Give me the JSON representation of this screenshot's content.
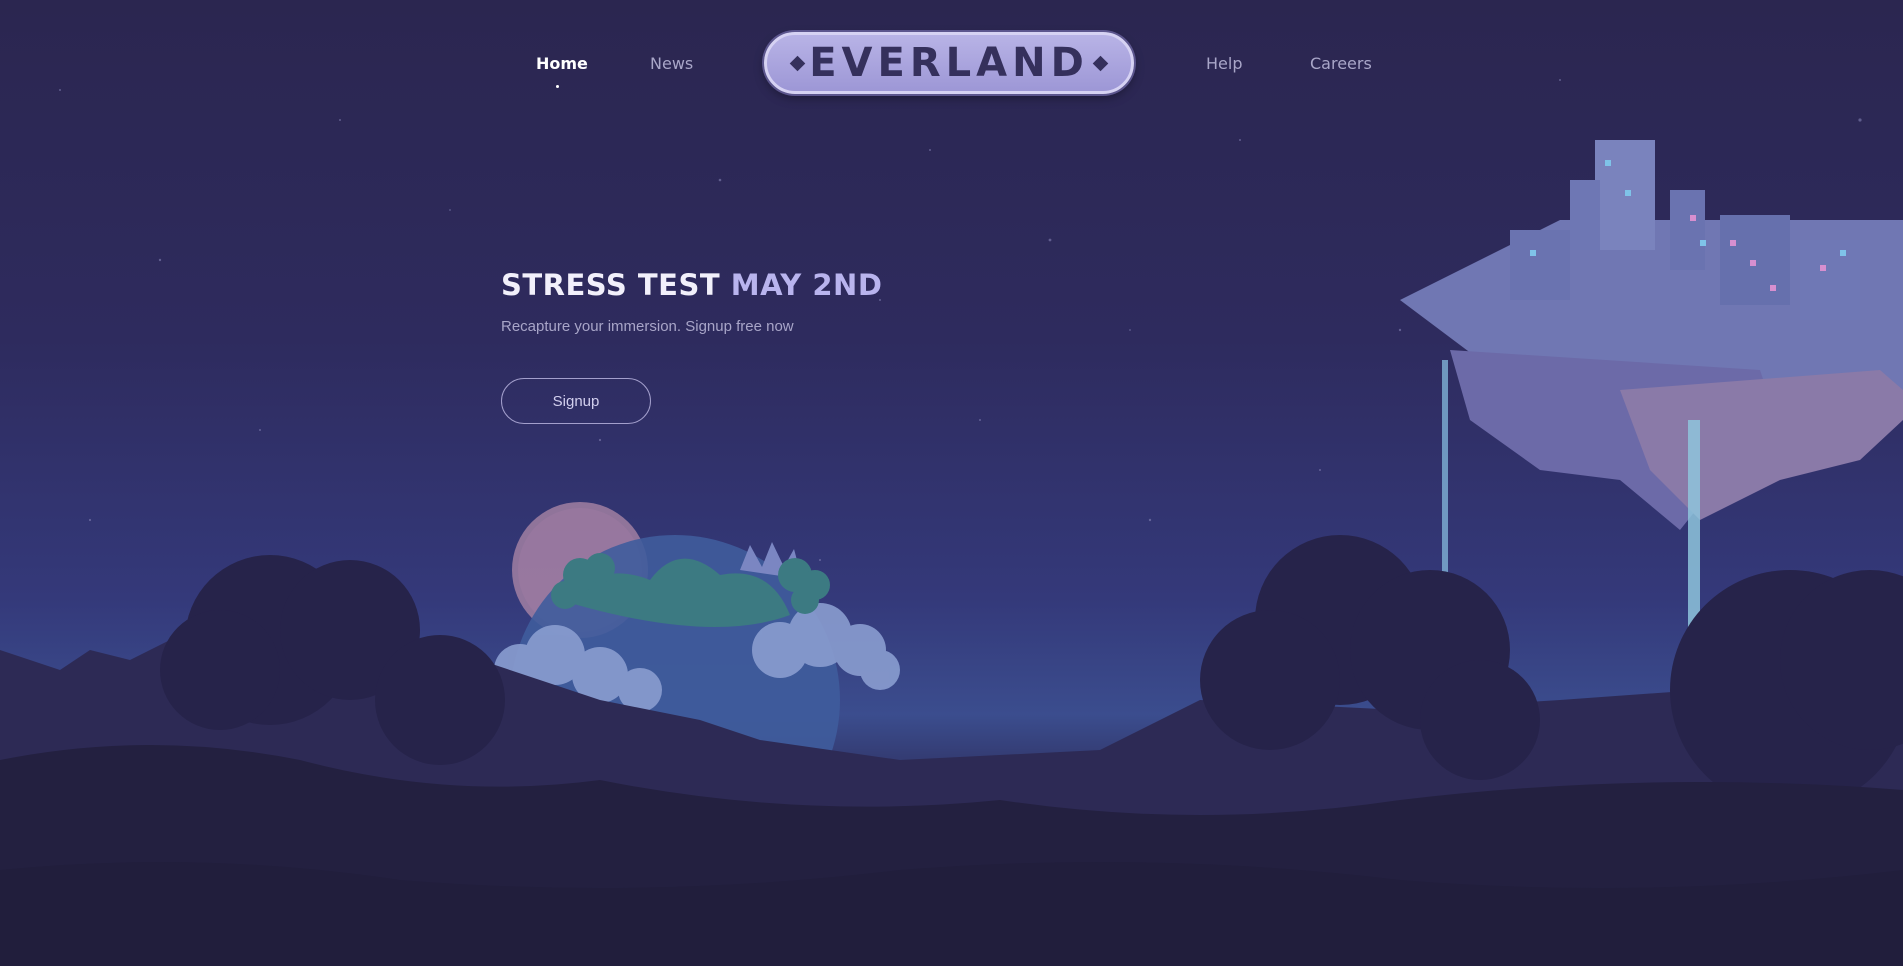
{
  "nav": {
    "left": [
      {
        "label": "Home",
        "active": true
      },
      {
        "label": "News",
        "active": false
      }
    ],
    "right": [
      {
        "label": "Help",
        "active": false
      },
      {
        "label": "Careers",
        "active": false
      }
    ],
    "logo": "EVERLAND"
  },
  "hero": {
    "title_part1": "STRESS TEST",
    "title_part2": "MAY 2ND",
    "subtitle": "Recapture your immersion. Signup free now",
    "cta_label": "Signup"
  },
  "colors": {
    "sky_top": "#2b2650",
    "sky_horizon": "#3b4d8e",
    "foreground": "#252240",
    "accent": "#b9b4ee"
  }
}
